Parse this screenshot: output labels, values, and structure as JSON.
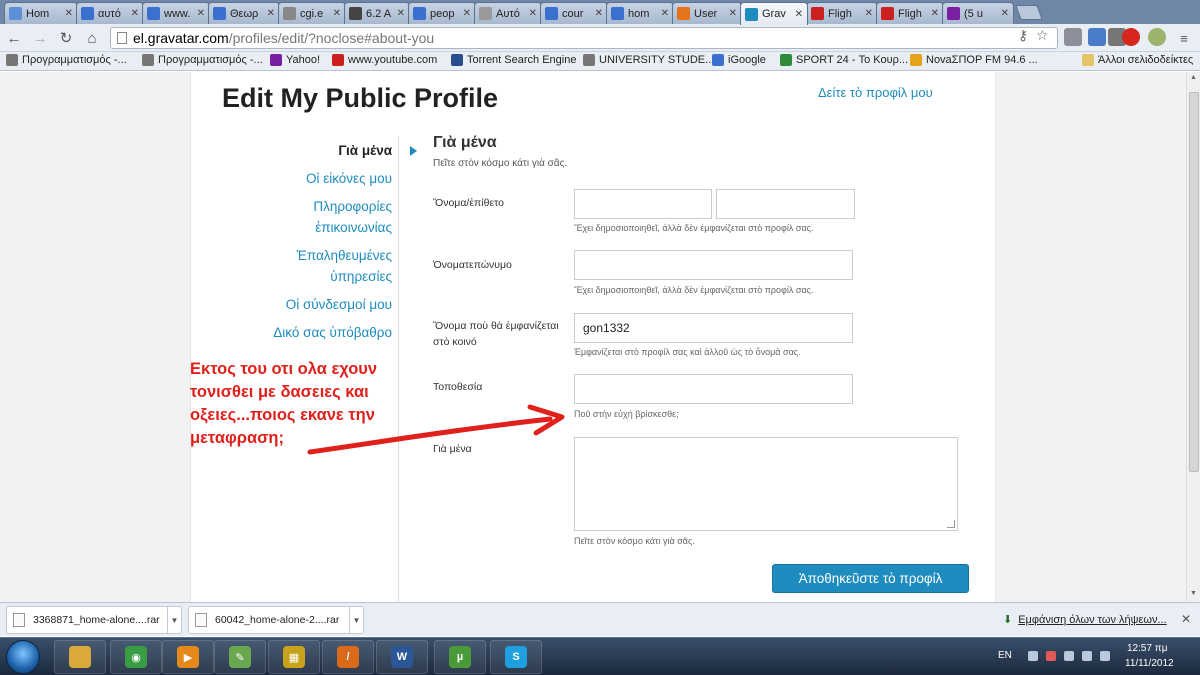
{
  "browser": {
    "tabs": [
      {
        "label": "Hom",
        "color": "#5b8fd6"
      },
      {
        "label": "αυτό",
        "color": "#3b6fd0"
      },
      {
        "label": "www.",
        "color": "#3b6fd0"
      },
      {
        "label": "Θεωρ",
        "color": "#3b6fd0"
      },
      {
        "label": "cgi.e",
        "color": "#888888"
      },
      {
        "label": "6.2 Α",
        "color": "#444444"
      },
      {
        "label": "peop",
        "color": "#3b6fd0"
      },
      {
        "label": "Αυτό",
        "color": "#999999"
      },
      {
        "label": "cour",
        "color": "#3b6fd0"
      },
      {
        "label": "hom",
        "color": "#3b6fd0"
      },
      {
        "label": "User",
        "color": "#e5731a"
      },
      {
        "label": "Grav",
        "color": "#1e8cbe"
      },
      {
        "label": "Fligh",
        "color": "#cc1f1f"
      },
      {
        "label": "Fligh",
        "color": "#cc1f1f"
      },
      {
        "label": "(5 u",
        "color": "#7b1fa2"
      }
    ],
    "url_host": "el.gravatar.com",
    "url_path": "/profiles/edit/?noclose#about-you",
    "bookmarks": [
      {
        "label": "Προγραμματισμός -...",
        "color": "#777777"
      },
      {
        "label": "Προγραμματισμός -...",
        "color": "#777777"
      },
      {
        "label": "Yahoo!",
        "color": "#7b1fa2"
      },
      {
        "label": "www.youtube.com",
        "color": "#cc1f1f"
      },
      {
        "label": "Torrent Search Engine",
        "color": "#2a4d8f"
      },
      {
        "label": "UNIVERSITY STUDE...",
        "color": "#777777"
      },
      {
        "label": "iGoogle",
        "color": "#3b6fd0"
      },
      {
        "label": "SPORT 24 - Το Κουρ...",
        "color": "#2e8b3a"
      },
      {
        "label": "NovaΣΠΟΡ FM 94.6 ...",
        "color": "#e5a21a"
      }
    ],
    "other_bookmarks": "Άλλοι σελιδοδείκτες"
  },
  "page": {
    "title": "Edit My Public Profile",
    "view_profile_link": "Δείτε τὸ προφίλ μου",
    "nav": [
      {
        "label": "Γιὰ μένα",
        "current": true
      },
      {
        "label": "Οἱ εἰκόνες μου",
        "current": false
      },
      {
        "label": "Πληροφορίες ἐπικοινωνίας",
        "current": false
      },
      {
        "label": "Ἐπαληθευμένες ὑπηρεσίες",
        "current": false
      },
      {
        "label": "Οἱ σύνδεσμοί μου",
        "current": false
      },
      {
        "label": "Δικό σας ὑπόβαθρο",
        "current": false
      }
    ],
    "section_title": "Γιὰ μένα",
    "section_subtitle": "Πεῖτε στὸν κόσμο κάτι γιὰ σᾶς.",
    "fields": {
      "name_label": "Ὄνομα/ἐπίθετο",
      "name_hint": "Ἔχει δημοσιοποιηθεῖ, ἀλλὰ δὲν ἐμφανίζεται στὸ προφίλ σας.",
      "first_name_value": "",
      "last_name_value": "",
      "fullname_label": "Ὀνοματεπώνυμο",
      "fullname_hint": "Ἔχει δημοσιοποιηθεῖ, ἀλλὰ δὲν ἐμφανίζεται στὸ προφίλ σας.",
      "fullname_value": "",
      "display_label": "Ὄνομα ποὺ θὰ ἐμφανίζεται στὸ κοινό",
      "display_value": "gon1332",
      "display_hint": "Ἐμφανίζεται στὸ προφίλ σας καὶ ἀλλοῦ ὡς τὸ ὄνομά σας.",
      "location_label": "Τοποθεσία",
      "location_value": "",
      "location_hint": "Ποῦ στὴν εὐχή βρίσκεσθε;",
      "about_label": "Γιὰ μένα",
      "about_value": "",
      "about_hint": "Πεῖτε στὸν κόσμο κάτι γιὰ σᾶς."
    },
    "save_button": "Ἀποθηκεῦστε τὸ προφίλ",
    "annotation_lines": [
      "Εκτος του οτι ολα εχουν",
      "τονισθει με δασειες και",
      "οξειες...ποιος εκανε την",
      "μεταφραση;"
    ],
    "annotation_color": "#e0201b",
    "accent_color": "#1e8cbe"
  },
  "downloads": {
    "items": [
      {
        "label": "3368871_home-alone....rar"
      },
      {
        "label": "60042_home-alone-2....rar"
      }
    ],
    "show_all": "Εμφάνιση όλων των λήψεων..."
  },
  "taskbar": {
    "apps": [
      {
        "name": "file-explorer-icon",
        "color": "#d9a93c",
        "glyph": ""
      },
      {
        "name": "chrome-icon",
        "color": "#3a9d45",
        "glyph": "◉"
      },
      {
        "name": "media-player-icon",
        "color": "#e58a1a",
        "glyph": "▶"
      },
      {
        "name": "notepad-plus-icon",
        "color": "#6aa84f",
        "glyph": "✎"
      },
      {
        "name": "vmware-icon",
        "color": "#c9a21c",
        "glyph": "▦"
      },
      {
        "name": "sublime-icon",
        "color": "#d86a1a",
        "glyph": "/"
      },
      {
        "name": "word-icon",
        "color": "#2b5797",
        "glyph": "W"
      },
      {
        "name": "utorrent-icon",
        "color": "#4a9a3a",
        "glyph": "µ"
      },
      {
        "name": "skype-icon",
        "color": "#1ea0e0",
        "glyph": "S"
      }
    ],
    "language": "EN",
    "time": "12:57 πμ",
    "date": "11/11/2012"
  }
}
